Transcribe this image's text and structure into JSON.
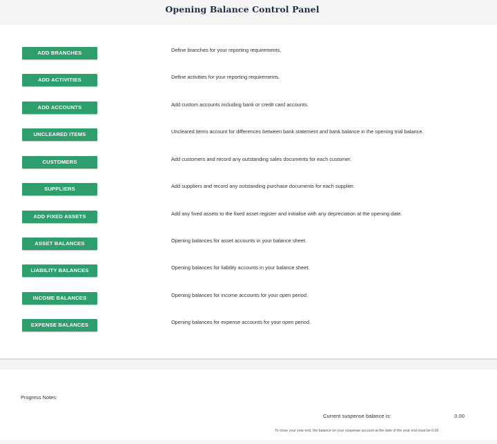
{
  "header": {
    "title": "Opening Balance Control Panel"
  },
  "actions": [
    {
      "label": "ADD BRANCHES",
      "description": "Define branches for your reporting requirements."
    },
    {
      "label": "ADD ACTIVITIES",
      "description": "Define activities for your reporting requirements."
    },
    {
      "label": "ADD ACCOUNTS",
      "description": "Add custom accounts including bank or credit card accounts."
    },
    {
      "label": "UNCLEARED ITEMS",
      "description": "Uncleared items account for differences between bank statement and bank balance in the opening trial balance."
    },
    {
      "label": "CUSTOMERS",
      "description": "Add customers and record any outstanding sales documents for each customer."
    },
    {
      "label": "SUPPLIERS",
      "description": "Add suppliers and record any outstanding purchase documents for each supplier."
    },
    {
      "label": "ADD FIXED ASSETS",
      "description": "Add any fixed assets to the fixed asset register and initialise with any depreciation at the opening date."
    },
    {
      "label": "ASSET BALANCES",
      "description": "Opening balances for asset accounts in your balance sheet."
    },
    {
      "label": "LIABILITY BALANCES",
      "description": "Opening balances for liability accounts in your balance sheet."
    },
    {
      "label": "INCOME BALANCES",
      "description": "Opening balances for income accounts for your open period."
    },
    {
      "label": "EXPENSE BALANCES",
      "description": "Opening balances for expense accounts for your open period."
    }
  ],
  "footer": {
    "progress_notes_label": "Progress Notes:",
    "suspense_label": "Current suspense balance is:",
    "suspense_value": "0.00",
    "suspense_note": "To close your year end, the balance on your suspense account at the date of the year end must be 0.00"
  },
  "colors": {
    "button": "#2e9e6c",
    "title": "#1f2d4a"
  }
}
